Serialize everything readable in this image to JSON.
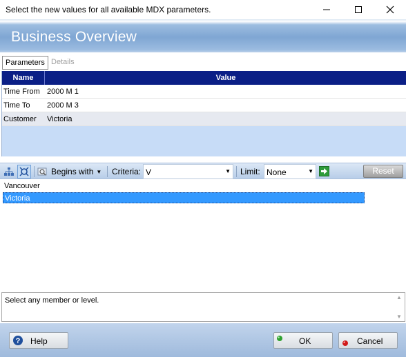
{
  "window": {
    "title": "Select the new values for all available MDX parameters.",
    "controls": [
      "minimize-icon",
      "maximize-icon",
      "close-icon"
    ]
  },
  "banner": {
    "title": "Business Overview"
  },
  "tabs": [
    {
      "label": "Parameters",
      "active": true
    },
    {
      "label": "Details",
      "active": false
    }
  ],
  "grid": {
    "headers": {
      "name": "Name",
      "value": "Value"
    },
    "rows": [
      {
        "name": "Time From",
        "value": "2000 M 1"
      },
      {
        "name": "Time To",
        "value": "2000 M 3"
      },
      {
        "name": "Customer",
        "value": "Victoria"
      }
    ],
    "selected_row": 2
  },
  "toolbar": {
    "match_mode": "Begins with",
    "criteria_label": "Criteria:",
    "criteria_value": "V",
    "limit_label": "Limit:",
    "limit_value": "None",
    "reset_label": "Reset"
  },
  "members": {
    "items": [
      {
        "label": "Vancouver",
        "selected": false
      },
      {
        "label": "Victoria",
        "selected": true
      }
    ]
  },
  "description": {
    "text": "Select any member or level."
  },
  "footer": {
    "help_label": "Help",
    "ok_label": "OK",
    "cancel_label": "Cancel"
  },
  "colors": {
    "grid_header": "#0b1f86",
    "selection": "#3399ff",
    "ok_dot": "#2fa12f",
    "cancel_dot": "#d11a1a",
    "help_icon": "#1f4f9c"
  }
}
